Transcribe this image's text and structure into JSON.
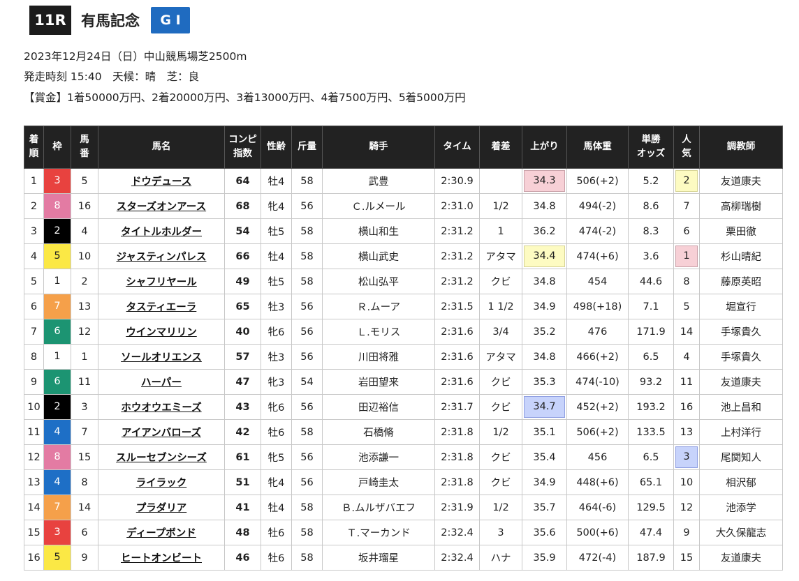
{
  "header": {
    "race_number": "11R",
    "race_name": "有馬記念",
    "grade": "G I",
    "date_course": "2023年12月24日（日）中山競馬場芝2500m",
    "start_weather": "発走時刻 15:40　天候：晴　芝：良",
    "prize": "【賞金】1着50000万円、2着20000万円、3着13000万円、4着7500万円、5着5000万円"
  },
  "columns": [
    [
      "着",
      "順"
    ],
    [
      "枠"
    ],
    [
      "馬",
      "番"
    ],
    [
      "馬名"
    ],
    [
      "コンピ",
      "指数"
    ],
    [
      "性齢"
    ],
    [
      "斤量"
    ],
    [
      "騎手"
    ],
    [
      "タイム"
    ],
    [
      "着差"
    ],
    [
      "上がり"
    ],
    [
      "馬体重"
    ],
    [
      "単勝",
      "オッズ"
    ],
    [
      "人",
      "気"
    ],
    [
      "調教師"
    ]
  ],
  "colors": {
    "waku": {
      "1": {
        "bg": "#ffffff",
        "fg": "#222222"
      },
      "2": {
        "bg": "#000000",
        "fg": "#ffffff"
      },
      "3": {
        "bg": "#e8423f",
        "fg": "#ffffff"
      },
      "4": {
        "bg": "#1e6fc6",
        "fg": "#ffffff"
      },
      "5": {
        "bg": "#fbe845",
        "fg": "#222222"
      },
      "6": {
        "bg": "#1c9472",
        "fg": "#ffffff"
      },
      "7": {
        "bg": "#f5a04a",
        "fg": "#ffffff"
      },
      "8": {
        "bg": "#e37ba3",
        "fg": "#ffffff"
      }
    }
  },
  "rows": [
    {
      "rank": "1",
      "waku": "3",
      "num": "5",
      "horse": "ドウデュース",
      "compi": "64",
      "compi_red": true,
      "sex_age": "牡4",
      "weight": "58",
      "jockey": "武豊",
      "time": "2:30.9",
      "margin": "",
      "last3f": "34.3",
      "last3f_hl": "pink",
      "body": "506(+2)",
      "odds": "5.2",
      "pop": "2",
      "pop_hl": "yellow",
      "trainer": "友道康夫"
    },
    {
      "rank": "2",
      "waku": "8",
      "num": "16",
      "horse": "スターズオンアース",
      "compi": "68",
      "sex_age": "牝4",
      "weight": "56",
      "jockey": "Ｃ.ルメール",
      "time": "2:31.0",
      "margin": "1/2",
      "last3f": "34.8",
      "body": "494(-2)",
      "odds": "8.6",
      "pop": "7",
      "trainer": "高柳瑞樹"
    },
    {
      "rank": "3",
      "waku": "2",
      "num": "4",
      "horse": "タイトルホルダー",
      "compi": "54",
      "sex_age": "牡5",
      "weight": "58",
      "jockey": "横山和生",
      "time": "2:31.2",
      "margin": "1",
      "last3f": "36.2",
      "body": "474(-2)",
      "odds": "8.3",
      "pop": "6",
      "trainer": "栗田徹"
    },
    {
      "rank": "4",
      "waku": "5",
      "num": "10",
      "horse": "ジャスティンパレス",
      "compi": "66",
      "sex_age": "牡4",
      "weight": "58",
      "jockey": "横山武史",
      "time": "2:31.2",
      "margin": "アタマ",
      "last3f": "34.4",
      "last3f_hl": "yellow",
      "body": "474(+6)",
      "odds": "3.6",
      "pop": "1",
      "pop_hl": "pink",
      "trainer": "杉山晴紀"
    },
    {
      "rank": "5",
      "waku": "1",
      "num": "2",
      "horse": "シャフリヤール",
      "compi": "49",
      "sex_age": "牡5",
      "weight": "58",
      "jockey": "松山弘平",
      "time": "2:31.2",
      "margin": "クビ",
      "last3f": "34.8",
      "body": "454",
      "odds": "44.6",
      "pop": "8",
      "trainer": "藤原英昭"
    },
    {
      "rank": "6",
      "waku": "7",
      "num": "13",
      "horse": "タスティエーラ",
      "compi": "65",
      "sex_age": "牡3",
      "weight": "56",
      "jockey": "Ｒ.ムーア",
      "time": "2:31.5",
      "margin": "1 1/2",
      "last3f": "34.9",
      "body": "498(+18)",
      "odds": "7.1",
      "pop": "5",
      "trainer": "堀宣行"
    },
    {
      "rank": "7",
      "waku": "6",
      "num": "12",
      "horse": "ウインマリリン",
      "compi": "40",
      "sex_age": "牝6",
      "weight": "56",
      "jockey": "Ｌ.モリス",
      "time": "2:31.6",
      "margin": "3/4",
      "last3f": "35.2",
      "body": "476",
      "odds": "171.9",
      "pop": "14",
      "trainer": "手塚貴久"
    },
    {
      "rank": "8",
      "waku": "1",
      "num": "1",
      "horse": "ソールオリエンス",
      "compi": "57",
      "sex_age": "牡3",
      "weight": "56",
      "jockey": "川田将雅",
      "time": "2:31.6",
      "margin": "アタマ",
      "last3f": "34.8",
      "body": "466(+2)",
      "odds": "6.5",
      "pop": "4",
      "trainer": "手塚貴久"
    },
    {
      "rank": "9",
      "waku": "6",
      "num": "11",
      "horse": "ハーパー",
      "compi": "47",
      "sex_age": "牝3",
      "weight": "54",
      "jockey": "岩田望来",
      "time": "2:31.6",
      "margin": "クビ",
      "last3f": "35.3",
      "body": "474(-10)",
      "odds": "93.2",
      "pop": "11",
      "trainer": "友道康夫"
    },
    {
      "rank": "10",
      "waku": "2",
      "num": "3",
      "horse": "ホウオウエミーズ",
      "compi": "43",
      "sex_age": "牝6",
      "weight": "56",
      "jockey": "田辺裕信",
      "time": "2:31.7",
      "margin": "クビ",
      "last3f": "34.7",
      "last3f_hl": "blue",
      "body": "452(+2)",
      "odds": "193.2",
      "pop": "16",
      "trainer": "池上昌和"
    },
    {
      "rank": "11",
      "waku": "4",
      "num": "7",
      "horse": "アイアンバローズ",
      "compi": "42",
      "sex_age": "牡6",
      "weight": "58",
      "jockey": "石橋脩",
      "time": "2:31.8",
      "margin": "1/2",
      "last3f": "35.1",
      "body": "506(+2)",
      "odds": "133.5",
      "pop": "13",
      "trainer": "上村洋行"
    },
    {
      "rank": "12",
      "waku": "8",
      "num": "15",
      "horse": "スルーセブンシーズ",
      "compi": "61",
      "sex_age": "牝5",
      "weight": "56",
      "jockey": "池添謙一",
      "time": "2:31.8",
      "margin": "クビ",
      "last3f": "35.4",
      "body": "456",
      "odds": "6.5",
      "pop": "3",
      "pop_hl": "blue",
      "trainer": "尾関知人"
    },
    {
      "rank": "13",
      "waku": "4",
      "num": "8",
      "horse": "ライラック",
      "compi": "51",
      "sex_age": "牝4",
      "weight": "56",
      "jockey": "戸崎圭太",
      "time": "2:31.8",
      "margin": "クビ",
      "last3f": "34.9",
      "body": "448(+6)",
      "odds": "65.1",
      "pop": "10",
      "trainer": "相沢郁"
    },
    {
      "rank": "14",
      "waku": "7",
      "num": "14",
      "horse": "プラダリア",
      "compi": "41",
      "sex_age": "牡4",
      "weight": "58",
      "jockey": "Ｂ.ムルザバエフ",
      "time": "2:31.9",
      "margin": "1/2",
      "last3f": "35.7",
      "body": "464(-6)",
      "odds": "129.5",
      "pop": "12",
      "trainer": "池添学"
    },
    {
      "rank": "15",
      "waku": "3",
      "num": "6",
      "horse": "ディープボンド",
      "compi": "48",
      "sex_age": "牡6",
      "weight": "58",
      "jockey": "Ｔ.マーカンド",
      "time": "2:32.4",
      "margin": "3",
      "last3f": "35.6",
      "body": "500(+6)",
      "odds": "47.4",
      "pop": "9",
      "trainer": "大久保龍志"
    },
    {
      "rank": "16",
      "waku": "5",
      "num": "9",
      "horse": "ヒートオンビート",
      "compi": "46",
      "sex_age": "牡6",
      "weight": "58",
      "jockey": "坂井瑠星",
      "time": "2:32.4",
      "margin": "ハナ",
      "last3f": "35.9",
      "body": "472(-4)",
      "odds": "187.9",
      "pop": "15",
      "trainer": "友道康夫"
    }
  ]
}
